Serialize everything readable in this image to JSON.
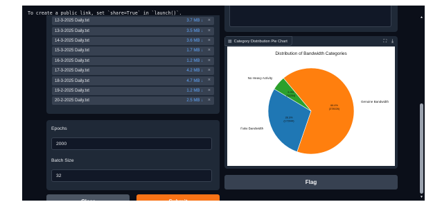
{
  "notice": "To create a public link, set `share=True` in `launch()`.",
  "files": [
    {
      "name": "12-3-2025 Daily.txt",
      "size": "3.7 MB ↓"
    },
    {
      "name": "13-3-2025 Daily.txt",
      "size": "3.5 MB ↓"
    },
    {
      "name": "14-3-2025 Daily.txt",
      "size": "3.6 MB ↓"
    },
    {
      "name": "15-3-2025 Daily.txt",
      "size": "1.7 MB ↓"
    },
    {
      "name": "16-3-2025 Daily.txt",
      "size": "1.2 MB ↓"
    },
    {
      "name": "17-3-2025 Daily.txt",
      "size": "4.2 MB ↓"
    },
    {
      "name": "18-3-2025 Daily.txt",
      "size": "4.7 MB ↓"
    },
    {
      "name": "19-2-2025 Daily.txt",
      "size": "1.2 MB ↓"
    },
    {
      "name": "20-2-2025 Daily.txt",
      "size": "2.5 MB ↓"
    }
  ],
  "close_glyph": "×",
  "params": {
    "epochs_label": "Epochs",
    "epochs_value": "2000",
    "batch_label": "Batch Size",
    "batch_value": "32"
  },
  "buttons": {
    "clear": "Clear",
    "submit": "Submit",
    "flag": "Flag"
  },
  "plot": {
    "label": "Category Distribution Pie Chart",
    "icons": [
      "chart-icon",
      "fullscreen-icon",
      "download-icon"
    ]
  },
  "chart_data": {
    "type": "pie",
    "title": "Distribution of Bandwidth Categories",
    "slices": [
      {
        "label": "Genuine Bandwidth",
        "percent": 66.4,
        "count_label": "(378026)",
        "color": "#ff7f0e"
      },
      {
        "label": "Fake Bandwidth",
        "percent": 28.3,
        "count_label": "(172044)",
        "color": "#1f77b4"
      },
      {
        "label": "No Heavy Activity",
        "percent": 5.3,
        "count_label": "(32294)",
        "color": "#2ca02c"
      }
    ]
  },
  "colors": {
    "accent": "#f97316",
    "background": "#0b0f19",
    "panel": "#1f2937",
    "link": "#60a5fa"
  }
}
